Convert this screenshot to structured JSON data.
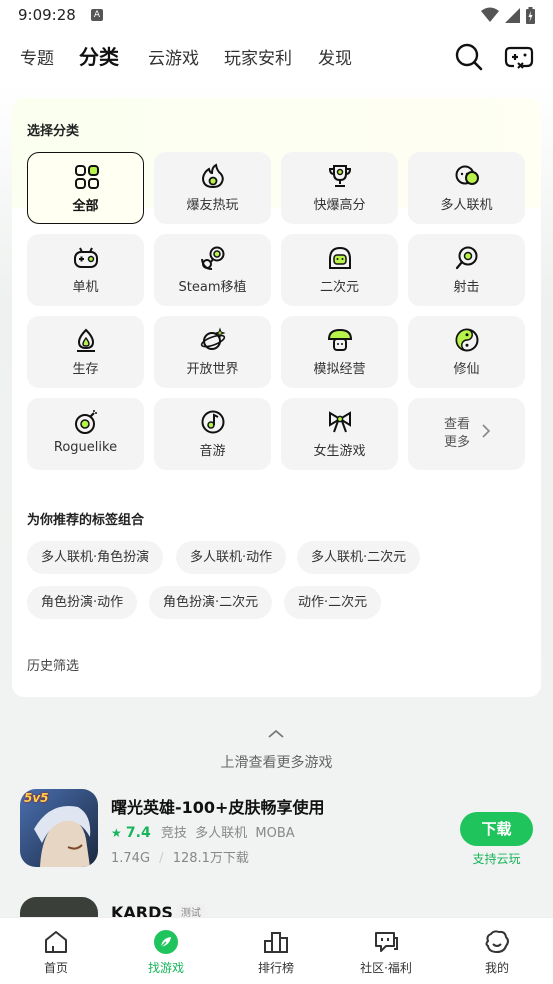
{
  "status": {
    "time": "9:09:28",
    "a_icon": "A"
  },
  "top_tabs": [
    {
      "label": "专题"
    },
    {
      "label": "分类"
    },
    {
      "label": "云游戏"
    },
    {
      "label": "玩家安利"
    },
    {
      "label": "发现"
    }
  ],
  "active_tab": "分类",
  "select_category": {
    "title": "选择分类",
    "items": [
      {
        "label": "全部",
        "icon": "grid-icon"
      },
      {
        "label": "爆友热玩",
        "icon": "fire-icon"
      },
      {
        "label": "快爆高分",
        "icon": "trophy-icon"
      },
      {
        "label": "多人联机",
        "icon": "multiplayer-icon"
      },
      {
        "label": "单机",
        "icon": "gamepad-icon"
      },
      {
        "label": "Steam移植",
        "icon": "steam-icon"
      },
      {
        "label": "二次元",
        "icon": "anime-icon"
      },
      {
        "label": "射击",
        "icon": "shoot-icon"
      },
      {
        "label": "生存",
        "icon": "campfire-icon"
      },
      {
        "label": "开放世界",
        "icon": "planet-icon"
      },
      {
        "label": "模拟经营",
        "icon": "mushroom-icon"
      },
      {
        "label": "修仙",
        "icon": "taiji-icon"
      },
      {
        "label": "Roguelike",
        "icon": "bomb-icon"
      },
      {
        "label": "音游",
        "icon": "music-icon"
      },
      {
        "label": "女生游戏",
        "icon": "bow-icon"
      }
    ],
    "more_label": "查看更多"
  },
  "recommended_tags": {
    "title": "为你推荐的标签组合",
    "chips": [
      "多人联机·角色扮演",
      "多人联机·动作",
      "多人联机·二次元",
      "角色扮演·动作",
      "角色扮演·二次元",
      "动作·二次元"
    ]
  },
  "history_filter": {
    "title": "历史筛选"
  },
  "swipe_hint": "上滑查看更多游戏",
  "games": [
    {
      "title": "曙光英雄-100+皮肤畅享使用",
      "rating": "7.4",
      "tags": "竞技  多人联机  MOBA",
      "size": "1.74G",
      "downloads": "128.1万下载",
      "download_label": "下载",
      "cloud_label": "支持云玩",
      "icon_text": "5v5"
    },
    {
      "title": "KARDS",
      "badge": "测试"
    }
  ],
  "bottom_nav": [
    {
      "label": "首页",
      "icon": "home-icon"
    },
    {
      "label": "找游戏",
      "icon": "find-game-icon"
    },
    {
      "label": "排行榜",
      "icon": "ranking-icon"
    },
    {
      "label": "社区·福利",
      "icon": "community-icon"
    },
    {
      "label": "我的",
      "icon": "profile-icon"
    }
  ],
  "colors": {
    "accent_green": "#1fc45d",
    "highlight_lime": "#b7f34a"
  }
}
